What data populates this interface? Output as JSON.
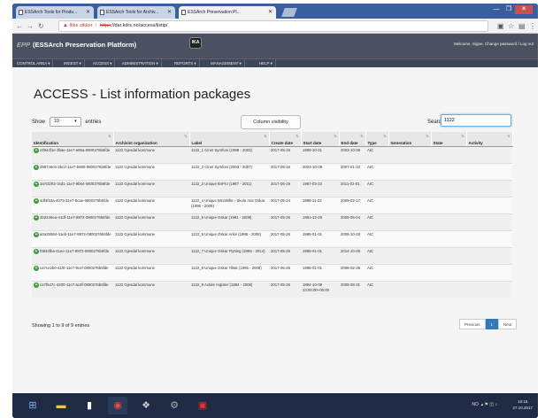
{
  "browser": {
    "tabs": [
      {
        "title": "ESSArch Tools for Produ...",
        "active": false
      },
      {
        "title": "ESSArch Tools for Archiv...",
        "active": false
      },
      {
        "title": "ESSArch Preservation Pl...",
        "active": true
      }
    ],
    "url": {
      "warning": "Ikke sikker",
      "protocol": "https",
      "path": "://dar.kdrs.no/access/listip/"
    }
  },
  "app": {
    "epp": "EPP",
    "title": "(ESSArch Preservation Platform)",
    "logo_text": "IKA",
    "welcome": "Welcome, Signe. Change password / Log out"
  },
  "menu": [
    "CONTROL AREA ▾",
    "INGEST ▾",
    "ACCESS ▾",
    "ADMINISTRATION ▾",
    "REPORTS ▾",
    "MANAGEMENT ▾",
    "HELP ▾"
  ],
  "page": {
    "title": "ACCESS - List information packages",
    "show_prefix": "Show",
    "show_value": "10",
    "show_suffix": "entries",
    "column_visibility": "Column visibility",
    "search_label": "Search:",
    "search_value": "1122"
  },
  "table": {
    "headers": [
      "Identification",
      "Archivist organization",
      "Label",
      "Create date",
      "Start date",
      "End date",
      "Type",
      "Generation",
      "State",
      "Activity"
    ],
    "rows": [
      [
        "c0944f1e-3bae-11e7-a96a-0800276b6fde",
        "1122 Gjesdal kommune",
        "1122_1 Cinet Symfoni (1999 - 2003)",
        "2017-05-16",
        "1999-10-31",
        "2003-10-09",
        "AIC",
        "",
        "",
        ""
      ],
      [
        "d98746c6-3bc2-11e7-b980-0800276b6fde",
        "1122 Gjesdal kommune",
        "1122_2 Cinet Symfoni (2003 - 2007)",
        "2017-05-16",
        "2003-10-09",
        "2007-01-10",
        "AIC",
        "",
        "",
        ""
      ],
      [
        "3a7d1f62-3cd1-11e7-9b64-0800276b6fde",
        "1122 Gjesdal kommune",
        "1122_3 Unique BvPro (1987 - 2011)",
        "2017-05-19",
        "1987-03-22",
        "2011-02-01",
        "AIC",
        "",
        "",
        ""
      ],
      [
        "4df3f34a-4075-11e7-9cae-0800276b6fde",
        "1122 Gjesdal kommune",
        "1122_4 Unique MinSkifte - Skole mot Oskar (1998 - 2009)",
        "2017-05-24",
        "1998-11-22",
        "2009-02-17",
        "AIC",
        "",
        "",
        ""
      ],
      [
        "2b2246ea-41df-11e7-8972-0800276b6fde",
        "1122 Gjesdal kommune",
        "1122_5 Unique Oskar (1991 - 2009)",
        "2017-05-26",
        "1991-12-29",
        "2009-05-04",
        "AIC",
        "",
        "",
        ""
      ],
      [
        "a0a25584-41eb-11e7-8972-0800276b6fde",
        "1122 Gjesdal kommune",
        "1122_6 Unique Oskar Arkiv (1995 - 2008)",
        "2017-05-26",
        "1995-01-01",
        "2008-10-28",
        "AIC",
        "",
        "",
        ""
      ],
      [
        "f0834fba-41ee-11e7-8972-0800276b6fde",
        "1122 Gjesdal kommune",
        "1122_7 Unique Oskar Flytting (1995 - 2014)",
        "2017-05-26",
        "1995-01-01",
        "2014-10-28",
        "AIC",
        "",
        "",
        ""
      ],
      [
        "ca7ce2b0-41f0-11e7-9cef-0800276b6fde",
        "1122 Gjesdal kommune",
        "1122_8 Unique Oskar Tiltak (1995 - 2008)",
        "2017-05-26",
        "1995-01-01",
        "2008-02-28",
        "AIC",
        "",
        "",
        ""
      ],
      [
        "ca7f647c-4200-11e7-ac8f-0800276b6fde",
        "1122 Gjesdal kommune",
        "1122_9 Avtale register (1894 - 2008)",
        "2017-05-26",
        "1894-10-08 23:00:00+00:00",
        "2008-08-31",
        "AIC",
        "",
        "",
        ""
      ]
    ]
  },
  "footer": {
    "info": "Showing 1 to 9 of 9 entries",
    "prev": "Previous",
    "page": "1",
    "next": "Next"
  },
  "taskbar": {
    "tray": "NO",
    "time": "10:15",
    "date": "27.10.2017"
  }
}
